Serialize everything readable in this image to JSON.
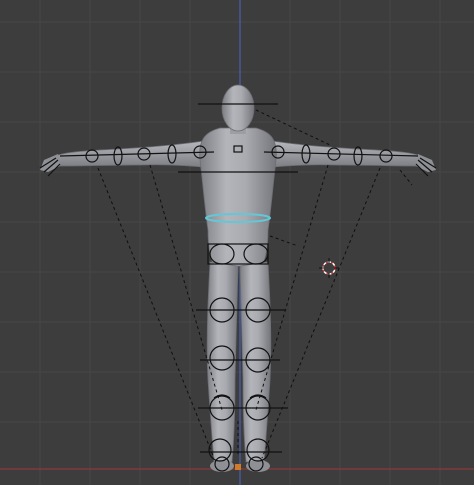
{
  "app": "Blender",
  "view": {
    "background": "#3d3d3d",
    "grid_color": "#474747",
    "x_axis_color": "#8a3b3b",
    "z_axis_color": "#4b5fb0",
    "mesh_color": "#a6a8ae",
    "mesh_shadow": "#7f8187",
    "selected_color": "#62c8d8",
    "cursor_color": "#c83a3a"
  },
  "scene": {
    "object": "humanoid-mesh",
    "pose": "T-pose",
    "selected_control": "waist-ring"
  }
}
